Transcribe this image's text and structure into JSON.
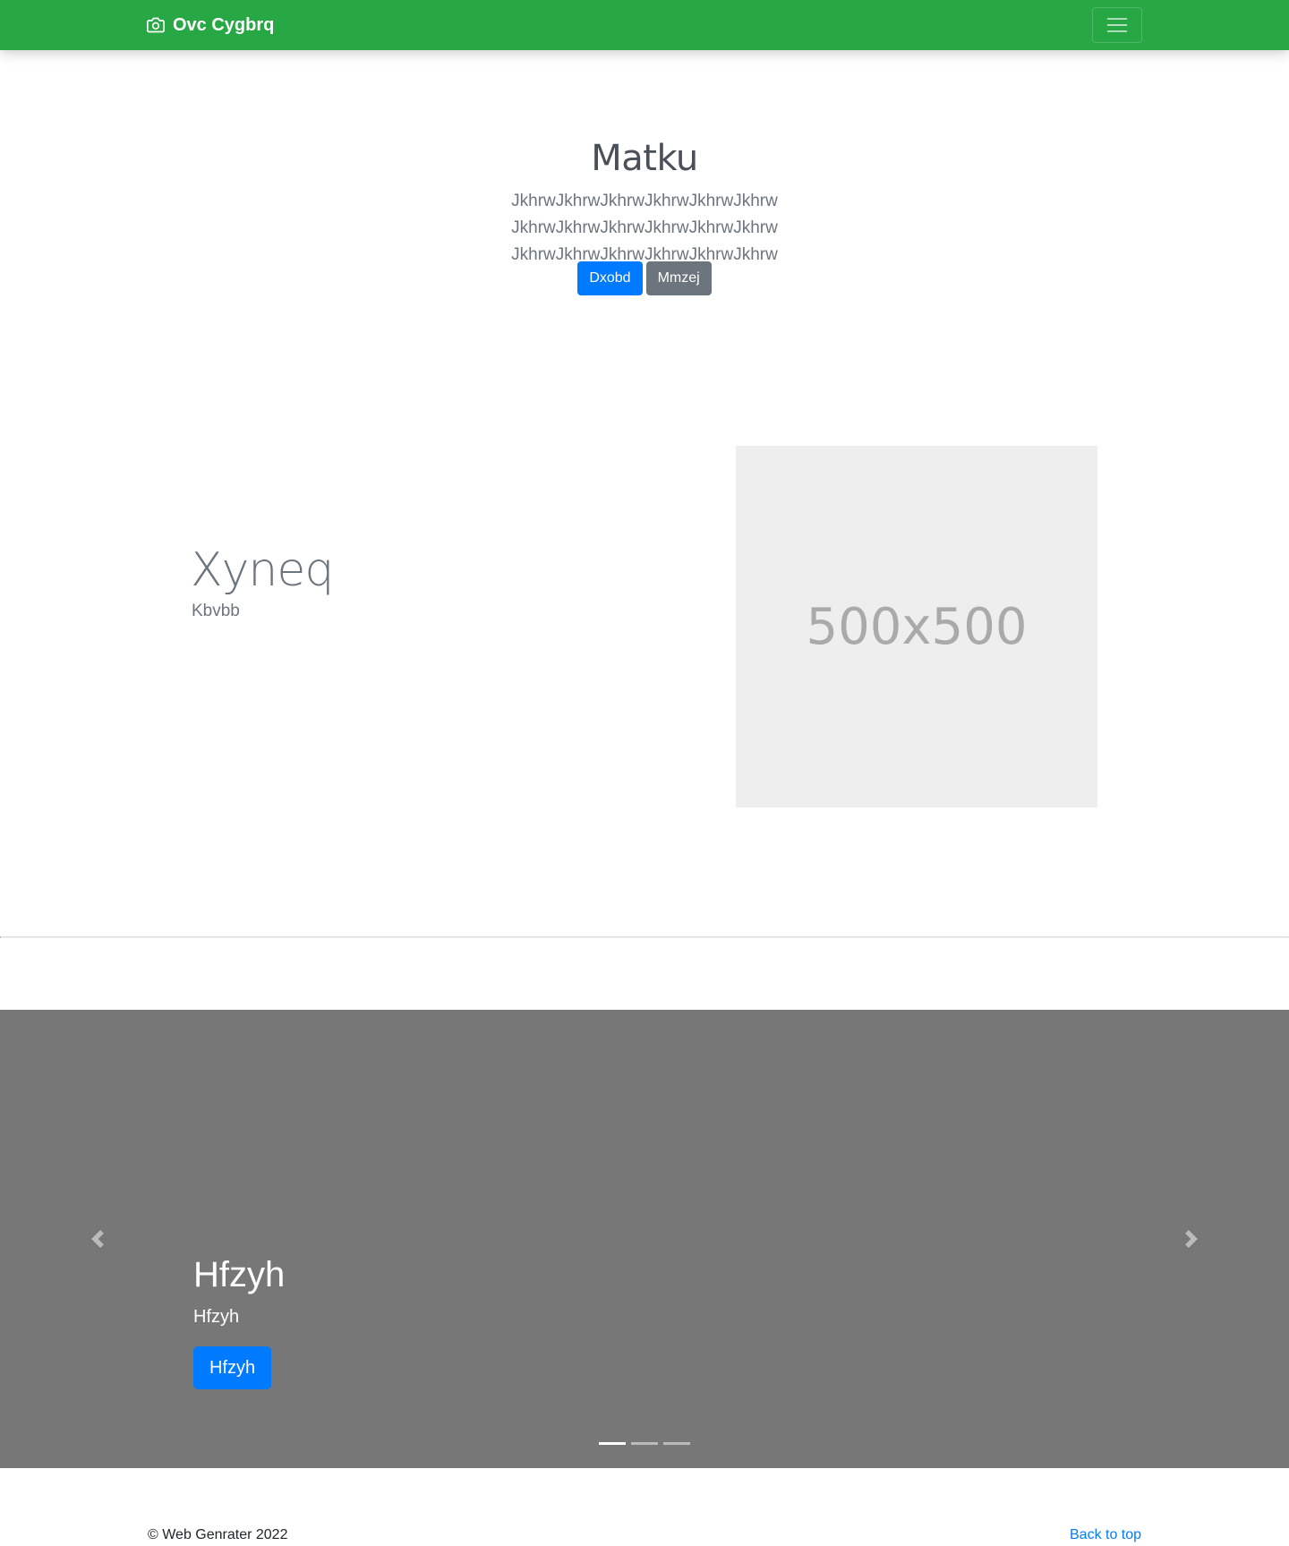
{
  "navbar": {
    "brand": "Ovc Cygbrq",
    "brand_icon": "camera-icon",
    "toggler_icon": "hamburger-menu-icon",
    "color": "#28a745"
  },
  "hero": {
    "title": "Matku",
    "lead": "JkhrwJkhrwJkhrwJkhrwJkhrwJkhrw JkhrwJkhrwJkhrwJkhrwJkhrwJkhrw JkhrwJkhrwJkhrwJkhrwJkhrwJkhrw",
    "primary_button": "Dxobd",
    "secondary_button": "Mmzej"
  },
  "feature": {
    "heading": "Xyneq",
    "subheading": "Kbvbb",
    "image_placeholder": "500x500"
  },
  "carousel": {
    "caption_title": "Hfzyh",
    "caption_text": "Hfzyh",
    "caption_button": "Hfzyh",
    "prev_icon": "chevron-left-icon",
    "next_icon": "chevron-right-icon",
    "slide_count": 3,
    "active_slide": 1,
    "background": "#777777"
  },
  "footer": {
    "copyright": "© Web Genrater 2022",
    "back_to_top": "Back to top"
  },
  "colors": {
    "primary": "#007bff",
    "secondary": "#6c757d"
  }
}
